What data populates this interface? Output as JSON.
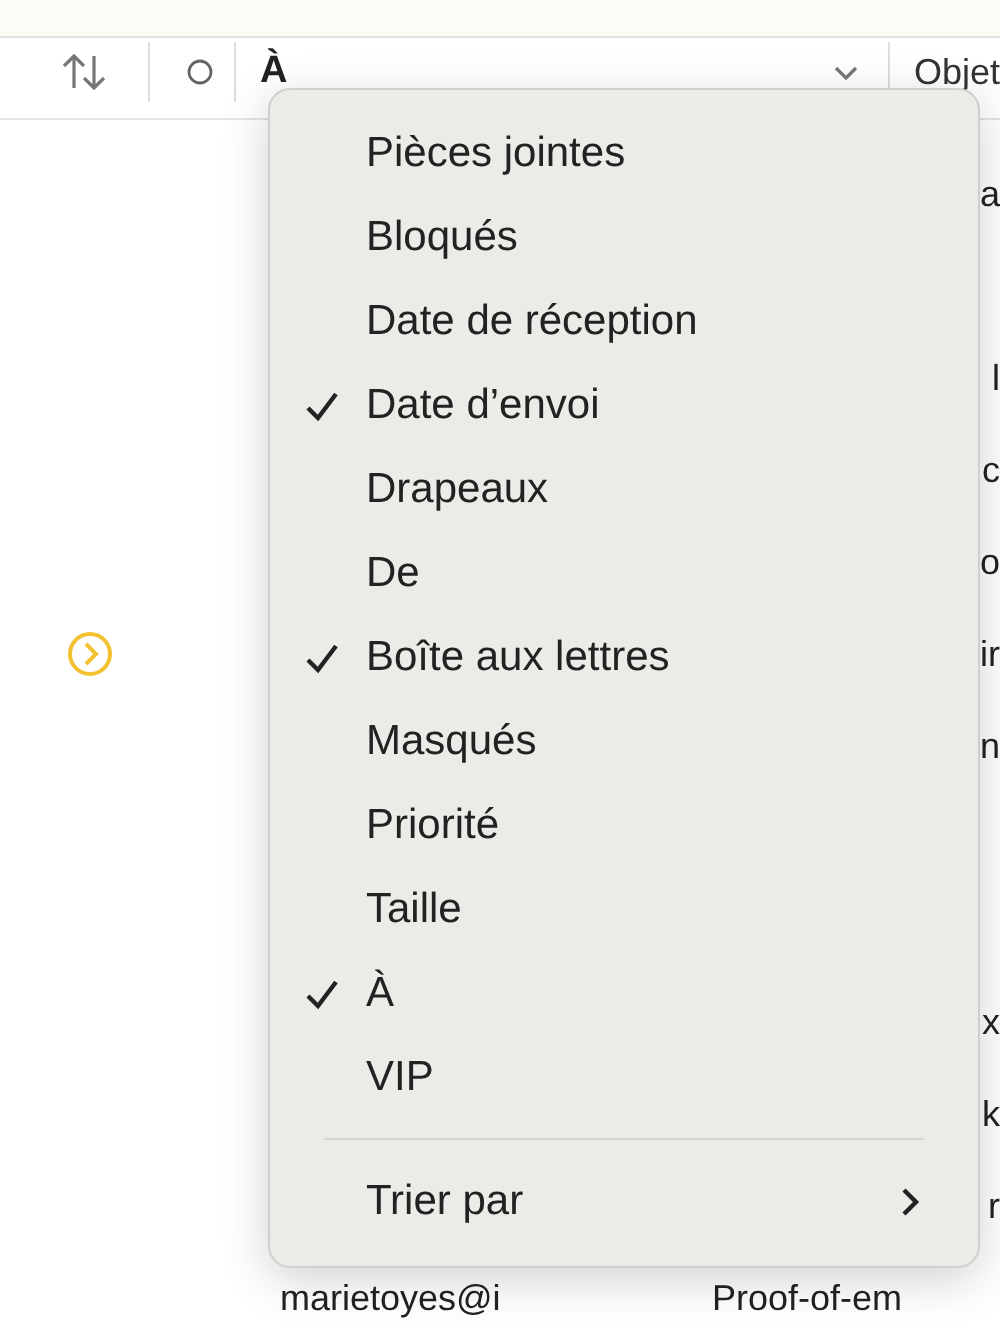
{
  "toolbar": {
    "sort_column": "À",
    "subject_column": "Objet"
  },
  "rows": [
    {
      "subject": "a",
      "flagged": false
    },
    {
      "flagged": false
    },
    {
      "subject": "l",
      "flagged": false
    },
    {
      "subject": "c",
      "flagged": false
    },
    {
      "subject": "o",
      "flagged": false
    },
    {
      "subject": "ir",
      "flagged": true
    },
    {
      "subject": "n",
      "flagged": false
    },
    {
      "flagged": false
    },
    {
      "flagged": false
    },
    {
      "subject": "x",
      "flagged": false
    },
    {
      "subject": "k",
      "flagged": false
    },
    {
      "subject": "r",
      "flagged": false
    },
    {
      "sender": "marietoyes@i",
      "subject": "Proof-of-em",
      "flagged": false
    }
  ],
  "menu": {
    "items": [
      {
        "label": "Pièces jointes",
        "checked": false
      },
      {
        "label": "Bloqués",
        "checked": false
      },
      {
        "label": "Date de réception",
        "checked": false
      },
      {
        "label": "Date d’envoi",
        "checked": true
      },
      {
        "label": "Drapeaux",
        "checked": false
      },
      {
        "label": "De",
        "checked": false
      },
      {
        "label": "Boîte aux lettres",
        "checked": true
      },
      {
        "label": "Masqués",
        "checked": false
      },
      {
        "label": "Priorité",
        "checked": false
      },
      {
        "label": "Taille",
        "checked": false
      },
      {
        "label": "À",
        "checked": true
      },
      {
        "label": "VIP",
        "checked": false
      }
    ],
    "submenu": {
      "label": "Trier par"
    }
  }
}
